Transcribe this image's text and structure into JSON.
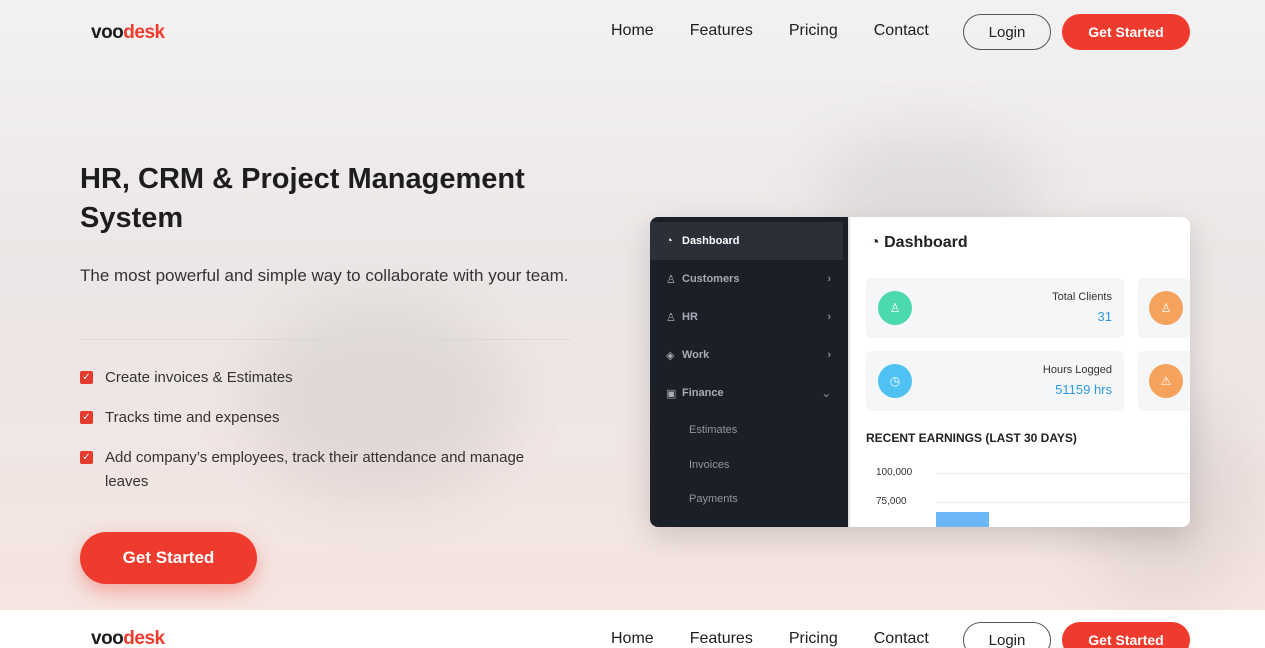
{
  "brand": {
    "prefix": "voo",
    "suffix": "desk"
  },
  "nav": {
    "items": [
      "Home",
      "Features",
      "Pricing",
      "Contact"
    ],
    "login": "Login",
    "get_started": "Get Started"
  },
  "hero": {
    "title": "HR, CRM & Project Management System",
    "subtitle": "The most powerful and simple way to collaborate with your team.",
    "features": [
      "Create invoices & Estimates",
      "Tracks time and expenses",
      "Add company’s employees, track their attendance and manage leaves"
    ],
    "cta": "Get Started"
  },
  "app": {
    "sidebar": {
      "items": [
        {
          "label": "Dashboard",
          "icon": "gauge-icon"
        },
        {
          "label": "Customers",
          "icon": "user-icon"
        },
        {
          "label": "HR",
          "icon": "person-icon"
        },
        {
          "label": "Work",
          "icon": "layers-icon"
        },
        {
          "label": "Finance",
          "icon": "money-icon"
        }
      ],
      "finance_sub": [
        "Estimates",
        "Invoices",
        "Payments"
      ]
    },
    "main": {
      "title": "Dashboard",
      "stats": [
        {
          "label": "Total Clients",
          "value": "31",
          "color": "#4cd9b0"
        },
        {
          "label": "Hours Logged",
          "value": "51159 hrs",
          "color": "#4fc1f2"
        }
      ],
      "side_cards": [
        {
          "color": "#f5a25d",
          "icon": "user-icon"
        },
        {
          "color": "#f5a25d",
          "icon": "warning-icon"
        }
      ],
      "earnings_title": "RECENT EARNINGS (LAST 30 DAYS)",
      "ticks": [
        "100,000",
        "75,000"
      ]
    }
  },
  "colors": {
    "accent": "#ef3b2d",
    "sidebar_bg": "#1b1f27",
    "link": "#2f9be0"
  }
}
